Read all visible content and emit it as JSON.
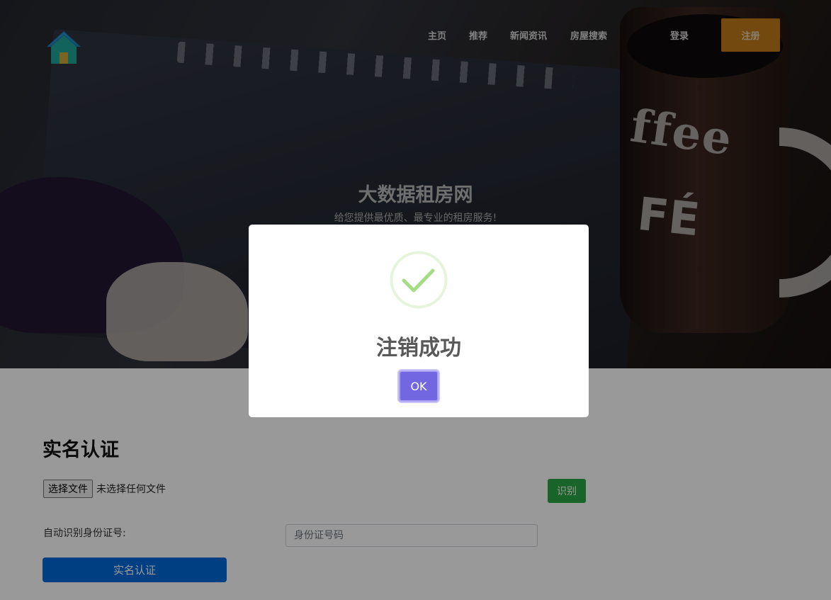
{
  "nav": {
    "links": [
      "主页",
      "推荐",
      "新闻资讯",
      "房屋搜索"
    ],
    "login": "登录",
    "register": "注册"
  },
  "hero": {
    "title": "大数据租房网",
    "subtitle": "给您提供最优质、最专业的租房服务!"
  },
  "verification": {
    "title": "实名认证",
    "file_button": "选择文件",
    "file_status": "未选择任何文件",
    "recognize_button": "识别",
    "id_label": "自动识别身份证号:",
    "id_placeholder": "身份证号码",
    "submit_button": "实名认证"
  },
  "modal": {
    "title": "注销成功",
    "ok": "OK"
  },
  "colors": {
    "register_button": "#c07a1a",
    "recognize_button": "#28a745",
    "submit_button": "#0069d9",
    "ok_button": "#7267e0",
    "success_check": "#a5dc86"
  },
  "icons": {
    "logo": "house-icon",
    "success": "checkmark-circle-icon"
  }
}
